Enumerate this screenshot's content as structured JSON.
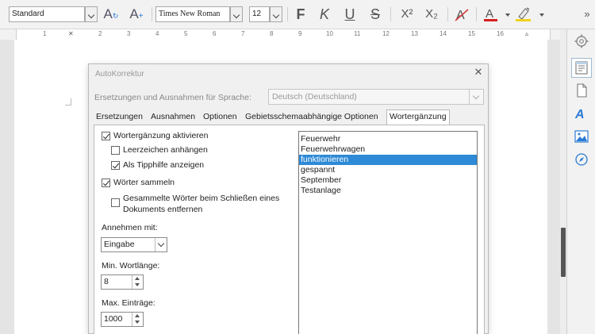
{
  "toolbar": {
    "style_value": "Standard",
    "font_value": "Times New Roman",
    "size_value": "12",
    "bold_label": "F",
    "italic_label": "K",
    "underline_label": "U",
    "strike_label": "S",
    "superscript_label": "X²",
    "subscript_label": "X₂",
    "overflow_label": "»",
    "font_color": "#d42020",
    "highlight_color": "#f2d11a"
  },
  "ruler": {
    "labels": [
      "1",
      "2",
      "3",
      "4",
      "5",
      "6",
      "7",
      "8",
      "9",
      "10",
      "11",
      "12",
      "13",
      "14",
      "15",
      "16"
    ]
  },
  "dialog": {
    "title": "AutoKorrektur",
    "close_label": "✕",
    "language_label": "Ersetzungen und Ausnahmen für Sprache:",
    "language_value": "Deutsch (Deutschland)",
    "tabs": [
      {
        "label": "Ersetzungen"
      },
      {
        "label": "Ausnahmen"
      },
      {
        "label": "Optionen"
      },
      {
        "label": "Gebietsschemaabhängige Optionen"
      },
      {
        "label": "Wortergänzung"
      }
    ],
    "options": {
      "enable_completion": "Wortergänzung aktivieren",
      "append_space": "Leerzeichen anhängen",
      "show_as_tip": "Als Tipphilfe anzeigen",
      "collect_words": "Wörter sammeln",
      "remove_on_close_1": "Gesammelte Wörter beim Schließen eines",
      "remove_on_close_2": "Dokuments entfernen",
      "accept_with_label": "Annehmen mit:",
      "accept_with_value": "Eingabe",
      "min_length_label": "Min. Wortlänge:",
      "min_length_value": "8",
      "max_entries_label": "Max. Einträge:",
      "max_entries_value": "1000"
    },
    "words": [
      "Feuerwehr",
      "Feuerwehrwagen",
      "funktionieren",
      "gespannt",
      "September",
      "Testanlage"
    ],
    "selected_word_index": 2
  }
}
